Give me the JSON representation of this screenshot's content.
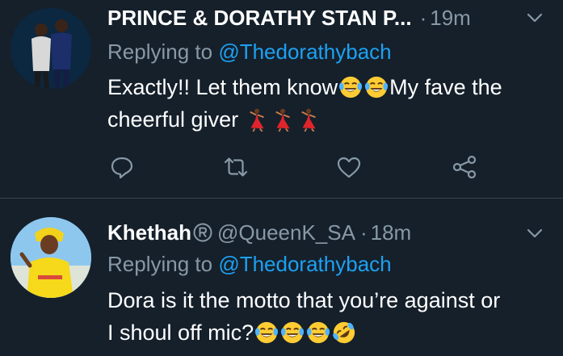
{
  "colors": {
    "background": "#15202b",
    "text_primary": "#ffffff",
    "text_secondary": "#8899a6",
    "link": "#1da1f2",
    "divider": "#38444d"
  },
  "tweets": [
    {
      "name": "PRINCE & DORATHY STAN P...",
      "dot": "·",
      "time": "19m",
      "reply_prefix": "Replying to ",
      "reply_mention": "@Thedorathybach",
      "body_line1_a": "Exactly!! Let them know",
      "body_line1_b": "My fave the",
      "body_line2": "cheerful giver",
      "emojis": [
        "tears-of-joy",
        "tears-of-joy",
        "dancer",
        "dancer",
        "dancer"
      ],
      "actions": [
        "reply-icon",
        "retweet-icon",
        "like-icon",
        "share-icon"
      ]
    },
    {
      "name": "Khethah",
      "badge": "registered-icon",
      "handle": "@QueenK_SA",
      "dot": "·",
      "time": "18m",
      "reply_prefix": "Replying to ",
      "reply_mention": "@Thedorathybach",
      "body_line1": "Dora is it the motto that you’re against or",
      "body_line2": "I shoul off mic?",
      "emojis": [
        "tears-of-joy",
        "tears-of-joy",
        "tears-of-joy",
        "rolling-on-floor-laughing"
      ]
    }
  ]
}
